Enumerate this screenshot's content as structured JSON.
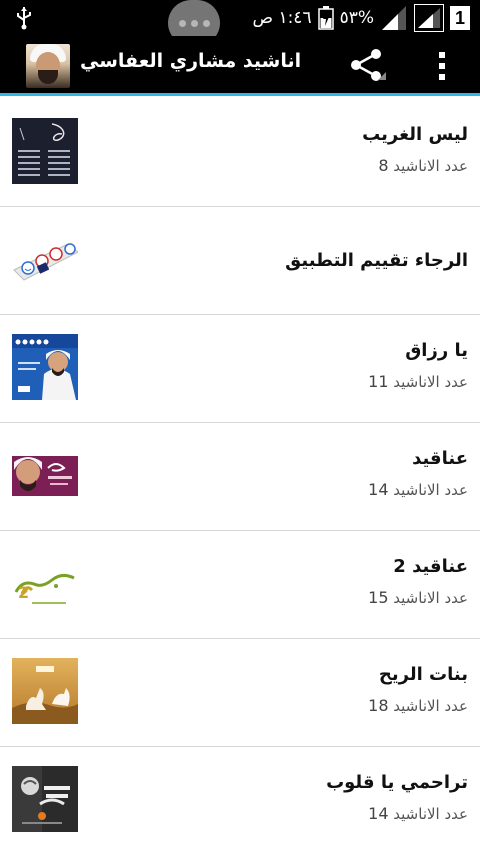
{
  "status_bar": {
    "time": "١:٤٦ ص",
    "battery_percent": "٥٣%",
    "sim_label": "1",
    "icons": [
      "usb-icon",
      "sim-icon",
      "signal-icon",
      "signal-icon",
      "battery-icon"
    ]
  },
  "app": {
    "title": "اناشيد مشاري العفاسي",
    "icons": [
      "share-icon",
      "overflow-menu-icon"
    ],
    "accent_color": "#33b5e5"
  },
  "list": {
    "items": [
      {
        "title": "ليس الغريب",
        "count_label": "عدد الاناشيد",
        "count": "8"
      },
      {
        "title": "الرجاء تقييم التطبيق",
        "count_label": "",
        "count": ""
      },
      {
        "title": "يا رزاق",
        "count_label": "عدد الاناشيد",
        "count": "11"
      },
      {
        "title": "عناقيد",
        "count_label": "عدد الاناشيد",
        "count": "14"
      },
      {
        "title": "عناقيد 2",
        "count_label": "عدد الاناشيد",
        "count": "15"
      },
      {
        "title": "بنات الريح",
        "count_label": "عدد الاناشيد",
        "count": "18"
      },
      {
        "title": "تراحمي يا قلوب",
        "count_label": "عدد الاناشيد",
        "count": "14"
      }
    ]
  }
}
